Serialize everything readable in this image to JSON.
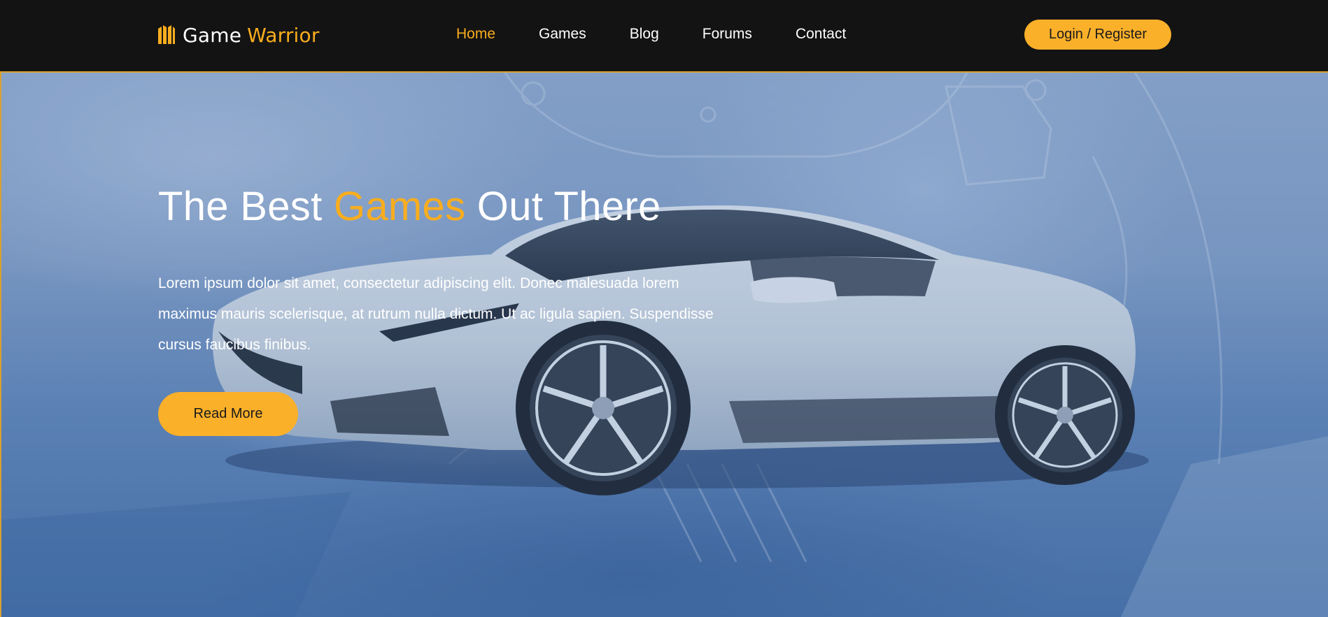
{
  "brand": {
    "name_primary": "Game",
    "name_accent": "Warrior",
    "logo_icon": "castle-icon",
    "accent_color": "#f9ad1e"
  },
  "nav": {
    "items": [
      {
        "label": "Home",
        "active": true
      },
      {
        "label": "Games",
        "active": false
      },
      {
        "label": "Blog",
        "active": false
      },
      {
        "label": "Forums",
        "active": false
      },
      {
        "label": "Contact",
        "active": false
      }
    ]
  },
  "header": {
    "login_label": "Login / Register",
    "background_color": "#131313"
  },
  "hero": {
    "title_prefix": "The Best ",
    "title_accent": "Games",
    "title_suffix": " Out There",
    "text": "Lorem ipsum dolor sit amet, consectetur adipiscing elit. Donec malesuada lorem maximus mauris scelerisque, at rutrum nulla dictum. Ut ac ligula sapien. Suspendisse cursus faucibus finibus.",
    "button_label": "Read More",
    "background_image": "white-sports-car-over-robot"
  }
}
